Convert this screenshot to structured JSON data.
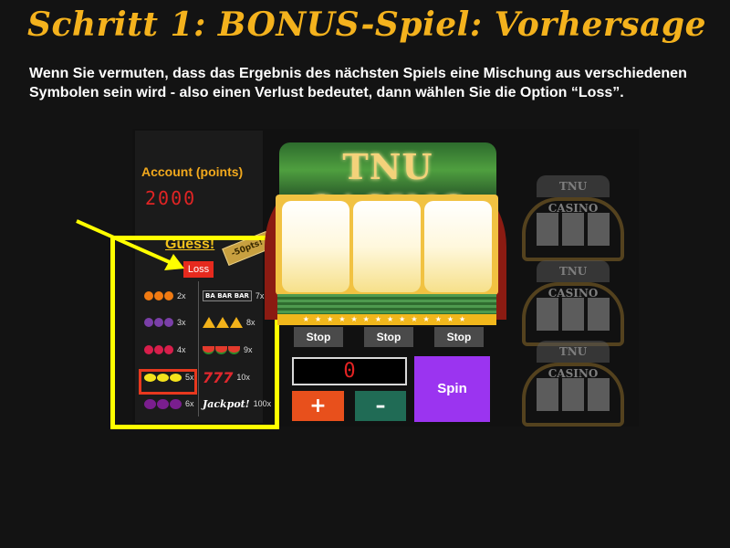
{
  "heading": "Schritt 1: BONUS-Spiel: Vorhersage",
  "description": "Wenn Sie vermuten, dass das Ergebnis des nächsten Spiels eine Mischung aus verschiedenen Symbolen sein wird - also einen Verlust bedeutet, dann wählen Sie die Option “Loss”.",
  "account": {
    "label": "Account (points)",
    "value": "2000"
  },
  "guess": {
    "label": "Guess!",
    "ribbon": "-50pts!",
    "loss_button": "Loss"
  },
  "paytable": {
    "left": [
      {
        "symbol": "orange-icon",
        "multiplier": "2x"
      },
      {
        "symbol": "grapes-icon",
        "multiplier": "3x"
      },
      {
        "symbol": "cherries-icon",
        "multiplier": "4x"
      },
      {
        "symbol": "lemon-icon",
        "multiplier": "5x"
      },
      {
        "symbol": "plum-icon",
        "multiplier": "6x"
      }
    ],
    "right": [
      {
        "symbol": "bar-icon",
        "label": "BA BAR BAR",
        "multiplier": "7x"
      },
      {
        "symbol": "bell-icon",
        "multiplier": "8x"
      },
      {
        "symbol": "watermelon-icon",
        "multiplier": "9x"
      },
      {
        "symbol": "seven-icon",
        "label": "777",
        "multiplier": "10x"
      },
      {
        "symbol": "jackpot-icon",
        "label": "Jackpot!",
        "multiplier": "100x"
      }
    ]
  },
  "machine": {
    "title": "TNU CASINO"
  },
  "controls": {
    "stop_1": "Stop",
    "stop_2": "Stop",
    "stop_3": "Stop",
    "bet": "0",
    "plus": "+",
    "minus": "–",
    "spin": "Spin"
  },
  "mini_machines": [
    "TNU CASINO",
    "TNU CASINO",
    "TNU CASINO"
  ],
  "colors": {
    "highlight": "#ffff00",
    "selection": "#e8381e",
    "title": "#f4b21d",
    "spin": "#9b34f0"
  }
}
